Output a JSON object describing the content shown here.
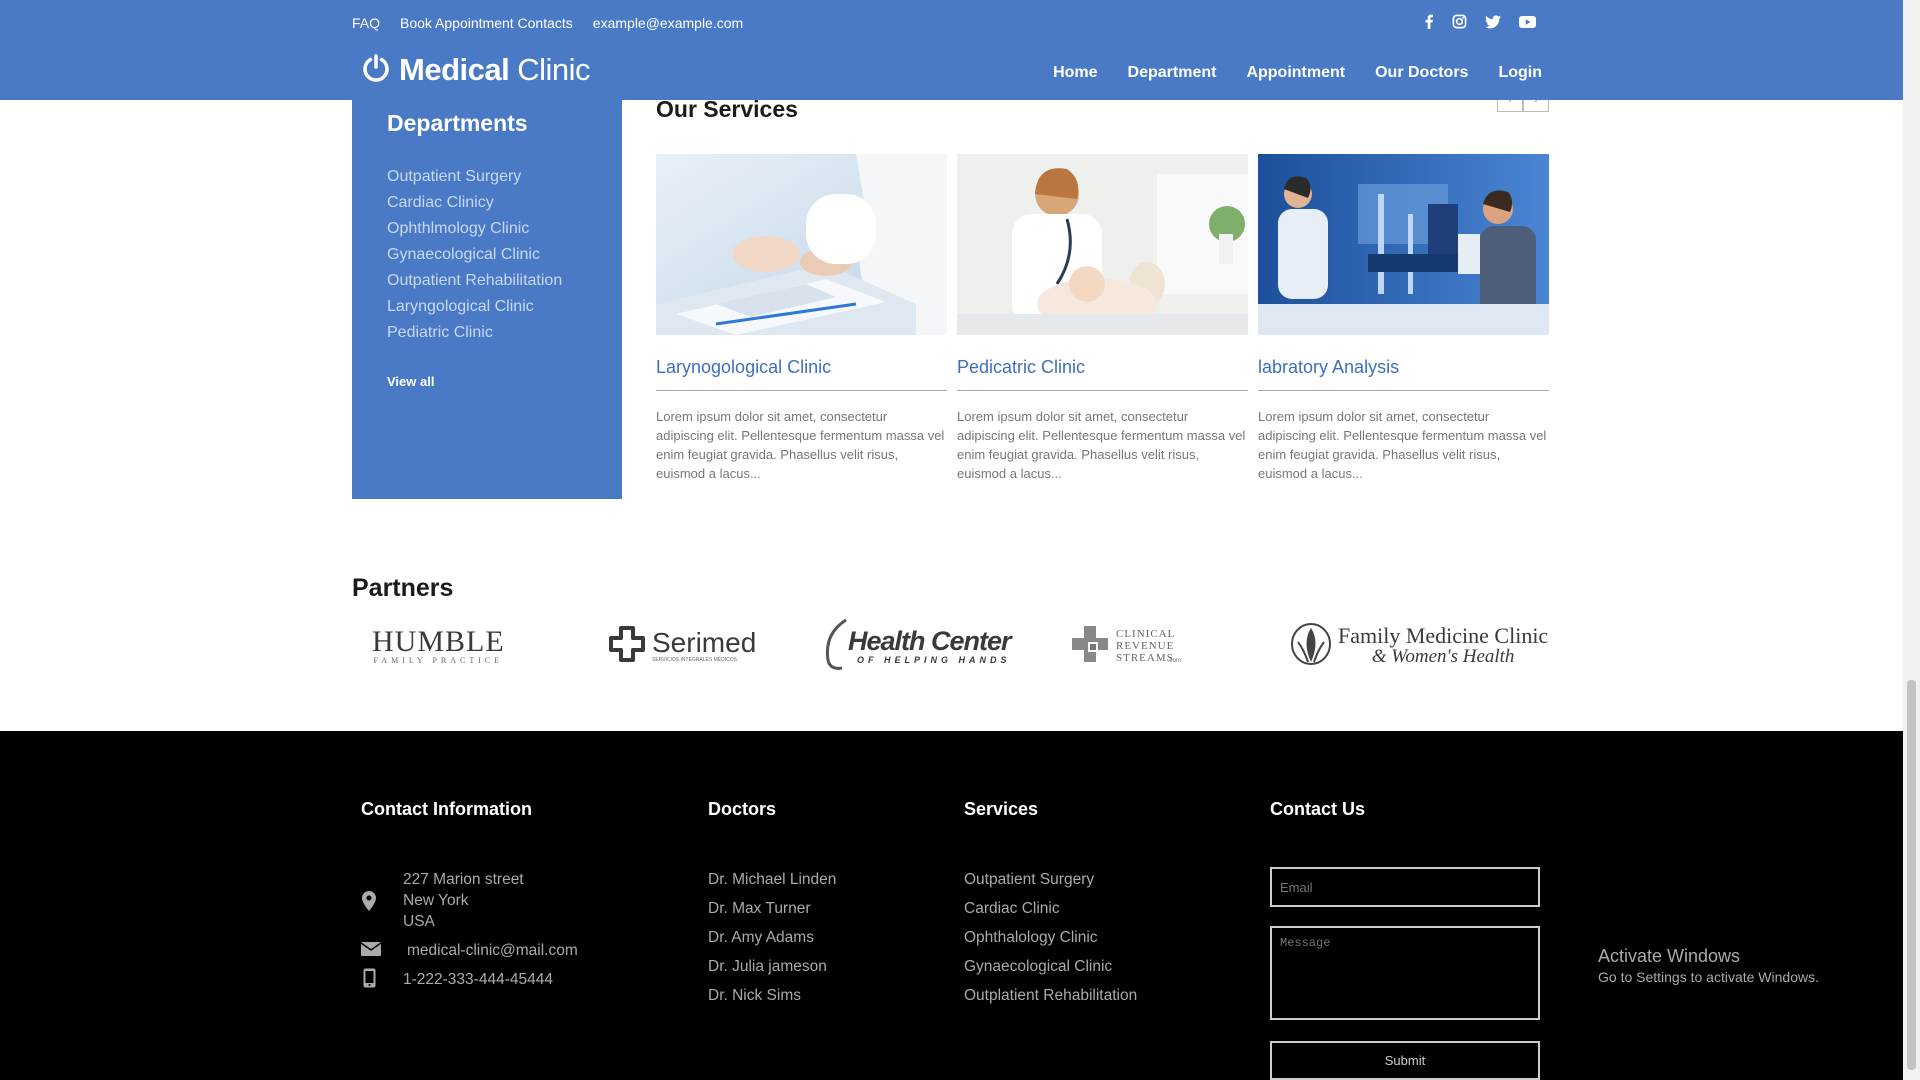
{
  "header": {
    "top_links": [
      "FAQ",
      "Book Appointment Contacts",
      "example@example.com"
    ],
    "logo_bold": "Medical",
    "logo_light": "Clinic",
    "nav": [
      "Home",
      "Department",
      "Appointment",
      "Our Doctors",
      "Login"
    ],
    "social_icons": [
      "facebook-icon",
      "instagram-icon",
      "twitter-icon",
      "youtube-icon"
    ],
    "brand_color": "#4a7ac5"
  },
  "departments": {
    "title": "Departments",
    "items": [
      "Outpatient Surgery",
      "Cardiac Clinicy",
      "Ophthlmology Clinic",
      "Gynaecological Clinic",
      "Outpatient Rehabilitation",
      "Laryngological Clinic",
      "Pediatric Clinic"
    ],
    "view_all": "View all"
  },
  "services": {
    "title": "Our Services",
    "cards": [
      {
        "title": "Larynogological Clinic",
        "desc": "Lorem ipsum dolor sit amet, consectetur adipiscing elit. Pellentesque fermentum massa vel enim feugiat gravida. Phasellus velit risus, euismod a lacus..."
      },
      {
        "title": "Pedicatric Clinic",
        "desc": "Lorem ipsum dolor sit amet, consectetur adipiscing elit. Pellentesque fermentum massa vel enim feugiat gravida. Phasellus velit risus, euismod a lacus..."
      },
      {
        "title": "labratory Analysis",
        "desc": "Lorem ipsum dolor sit amet, consectetur adipiscing elit. Pellentesque fermentum massa vel enim feugiat gravida. Phasellus velit risus, euismod a lacus..."
      }
    ]
  },
  "partners": {
    "title": "Partners",
    "logos": [
      {
        "name": "HUMBLE",
        "sub": "FAMILY PRACTICE"
      },
      {
        "name": "Serimed",
        "sub": "SERVICIOS INTEGRALES MÉDICOS"
      },
      {
        "name": "Health Center",
        "sub": "OF HELPING HANDS"
      },
      {
        "name": "CLINICAL REVENUE STREAMS",
        "sub": ".com"
      },
      {
        "name": "Family Medicine Clinic",
        "sub": "& Women's Health"
      }
    ]
  },
  "footer": {
    "contact_title": "Contact Information",
    "address_lines": [
      "227 Marion street",
      "New York",
      "USA"
    ],
    "email": "medical-clinic@mail.com",
    "phone": "1-222-333-444-45444",
    "doctors_title": "Doctors",
    "doctors": [
      "Dr. Michael Linden",
      "Dr. Max Turner",
      "Dr. Amy Adams",
      "Dr. Julia jameson",
      "Dr. Nick Sims"
    ],
    "services_title": "Services",
    "services": [
      "Outpatient Surgery",
      "Cardiac Clinic",
      "Ophthalology Clinic",
      "Gynaecological Clinic",
      "Outplatient Rehabilitation"
    ],
    "contactus_title": "Contact Us",
    "email_placeholder": "Email",
    "message_placeholder": "Message",
    "submit": "Submit"
  },
  "watermark": {
    "line1": "Activate Windows",
    "line2": "Go to Settings to activate Windows."
  }
}
